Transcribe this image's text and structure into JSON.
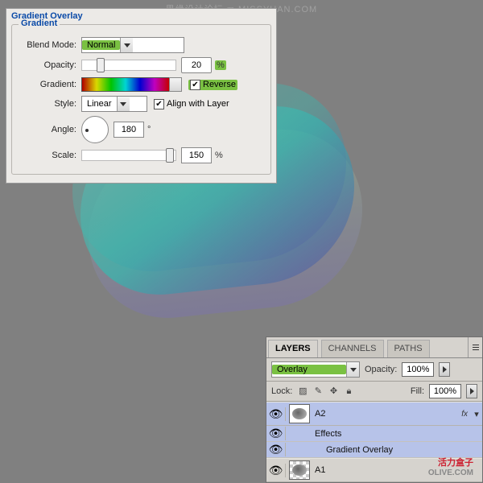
{
  "watermarks": {
    "top": "思缘设计论坛 m.MISSYUAN.COM",
    "brand": "活力盒子",
    "brand_en": "OLIVE.COM"
  },
  "gradient_overlay": {
    "title": "Gradient Overlay",
    "group_label": "Gradient",
    "blend_mode": {
      "label": "Blend Mode:",
      "value": "Normal"
    },
    "opacity": {
      "label": "Opacity:",
      "value": "20",
      "unit": "%"
    },
    "gradient": {
      "label": "Gradient:",
      "reverse_label": "Reverse",
      "reverse_checked": true
    },
    "style": {
      "label": "Style:",
      "value": "Linear",
      "align_label": "Align with Layer",
      "align_checked": true
    },
    "angle": {
      "label": "Angle:",
      "value": "180",
      "unit": "°"
    },
    "scale": {
      "label": "Scale:",
      "value": "150",
      "unit": "%"
    }
  },
  "layers_panel": {
    "tabs": {
      "layers": "LAYERS",
      "channels": "CHANNELS",
      "paths": "PATHS"
    },
    "blend_mode": "Overlay",
    "opacity": {
      "label": "Opacity:",
      "value": "100%"
    },
    "lock": {
      "label": "Lock:"
    },
    "fill": {
      "label": "Fill:",
      "value": "100%"
    },
    "items": {
      "a2": {
        "name": "A2",
        "fx": "fx"
      },
      "effects": "Effects",
      "grad_overlay": "Gradient Overlay",
      "a1": {
        "name": "A1"
      }
    }
  }
}
